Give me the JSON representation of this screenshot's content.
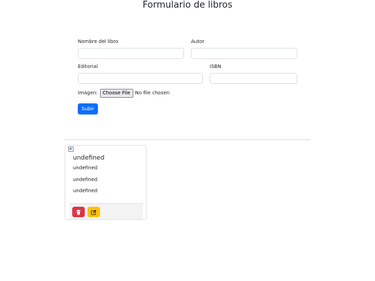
{
  "page": {
    "title": "Formulario de libros"
  },
  "form": {
    "book_name_label": "Nombre del libro",
    "book_name_value": "",
    "author_label": "Autor",
    "author_value": "",
    "publisher_label": "Editorial",
    "publisher_value": "",
    "isbn_label": "ISBN",
    "isbn_value": "",
    "image_label": "Imágen:",
    "choose_file_label": "Choose File",
    "no_file_text": "No file chosen",
    "submit_label": "Subir"
  },
  "cards": [
    {
      "title": "undefined",
      "line1": "undefined",
      "line2": "undefined",
      "line3": "undefined",
      "delete_icon": "trash-icon",
      "edit_icon": "edit-icon"
    }
  ],
  "colors": {
    "primary": "#0d6efd",
    "danger": "#dc3545",
    "warning": "#ffc107"
  }
}
